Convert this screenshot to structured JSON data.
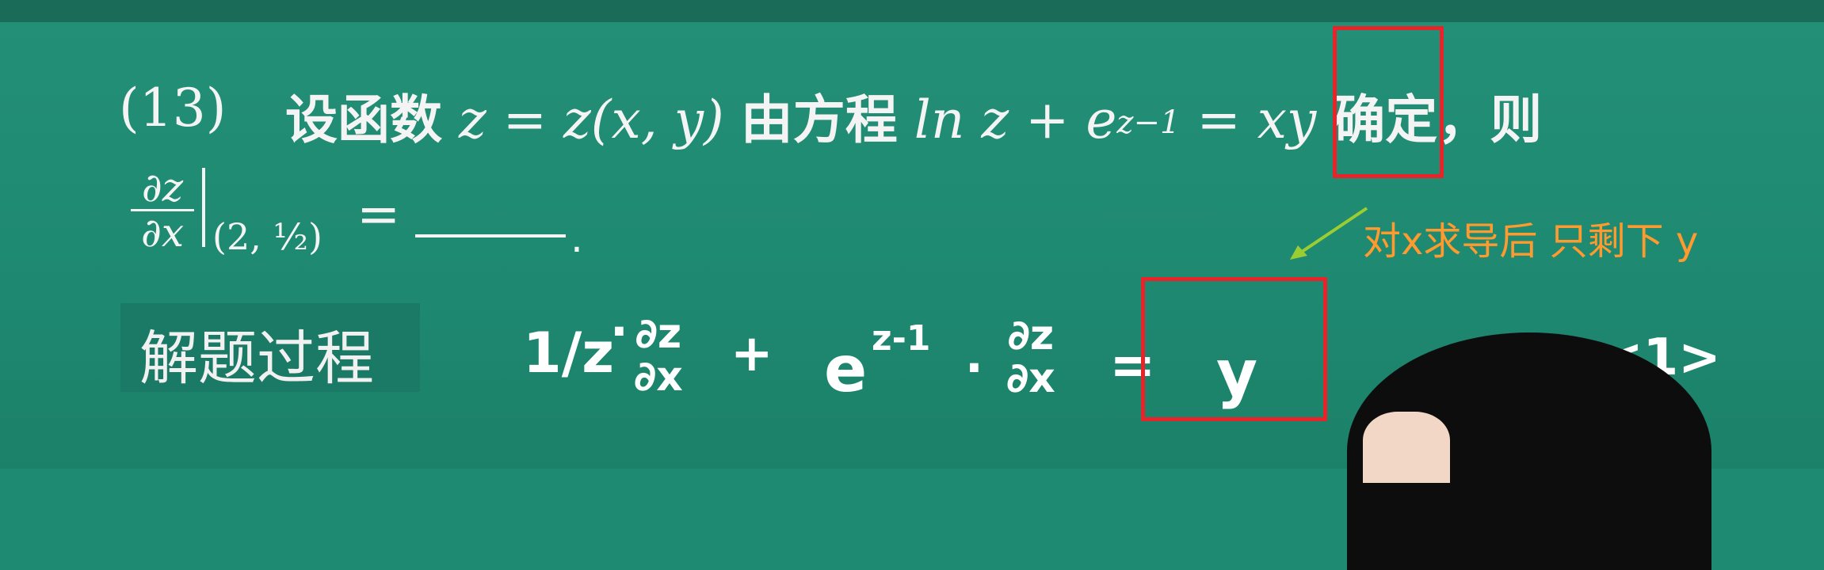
{
  "question": {
    "number": "(13)",
    "prefix": "设函数",
    "func": "z = z(x, y)",
    "mid": "由方程",
    "eq_left": "ln z + e",
    "exponent": "z−1",
    "eq_right": "= xy",
    "suffix": "确定，则",
    "deriv_num": "∂z",
    "deriv_den": "∂x",
    "eval_point": "(2, ½)",
    "equals": "="
  },
  "solution": {
    "label": "解题过程",
    "handwritten": {
      "t1": "1/z",
      "dot1": "·",
      "t2_num": "∂z",
      "t2_den": "∂x",
      "plus": "+",
      "t3": "e",
      "t3_exp": "z-1",
      "dot2": "·",
      "t4_num": "∂z",
      "t4_den": "∂x",
      "eq": "=",
      "rhs": "y",
      "eq_no": "<1>"
    }
  },
  "annotation": {
    "text": "对x求导后 只剩下 y",
    "color": "#ff9a2f",
    "arrow_color": "#9acd32",
    "box_color": "#e8242a"
  }
}
